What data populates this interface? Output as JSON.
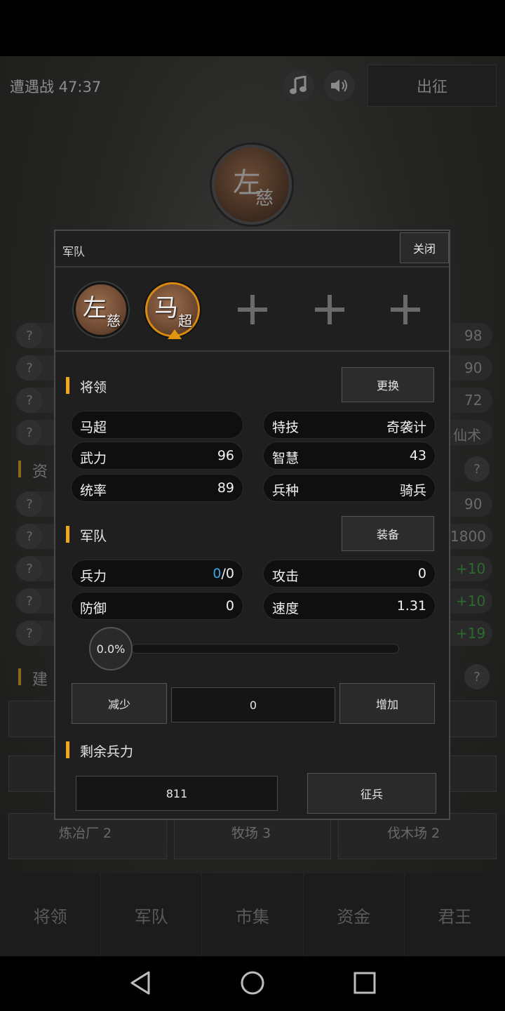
{
  "header": {
    "battle_title": "遭遇战 47:37",
    "music_icon": "music-note-icon",
    "sound_icon": "speaker-icon",
    "sortie_label": "出征"
  },
  "background": {
    "stats_right": [
      "98",
      "90",
      "72"
    ],
    "skill_fragment": "仙术",
    "section_resources": "资",
    "resource_right": [
      "90",
      "1800"
    ],
    "green_values": [
      "+10",
      "+10",
      "+19"
    ],
    "section_build": "建",
    "buildings": [
      "炼冶厂 2",
      "牧场 3",
      "伐木场 2"
    ]
  },
  "bottom_nav": {
    "tabs": [
      "将领",
      "军队",
      "市集",
      "资金",
      "君王"
    ]
  },
  "dialog": {
    "title": "军队",
    "close_label": "关闭",
    "slots": [
      {
        "glyph1": "左",
        "glyph2": "慈"
      },
      {
        "glyph1": "马",
        "glyph2": "超"
      }
    ],
    "general_section": {
      "title": "将领",
      "button": "更换",
      "name": "马超",
      "skill_label": "特技",
      "skill_value": "奇袭计",
      "force_label": "武力",
      "force_value": "96",
      "wisdom_label": "智慧",
      "wisdom_value": "43",
      "command_label": "统率",
      "command_value": "89",
      "troop_type_label": "兵种",
      "troop_type_value": "骑兵"
    },
    "army_section": {
      "title": "军队",
      "button": "装备",
      "troops_label": "兵力",
      "troops_current": "0",
      "troops_sep_max": "/0",
      "attack_label": "攻击",
      "attack_value": "0",
      "defense_label": "防御",
      "defense_value": "0",
      "speed_label": "速度",
      "speed_value": "1.31"
    },
    "slider": {
      "label": "0.0%",
      "fraction": 0.0
    },
    "decrease_label": "减少",
    "amount_value": "0",
    "increase_label": "增加",
    "remaining_section": {
      "title": "剩余兵力",
      "value": "811",
      "recruit_label": "征兵"
    }
  },
  "colors": {
    "accent": "#f0a818",
    "selected_ring": "#d88a10",
    "troops_blue": "#3aa6e8"
  }
}
